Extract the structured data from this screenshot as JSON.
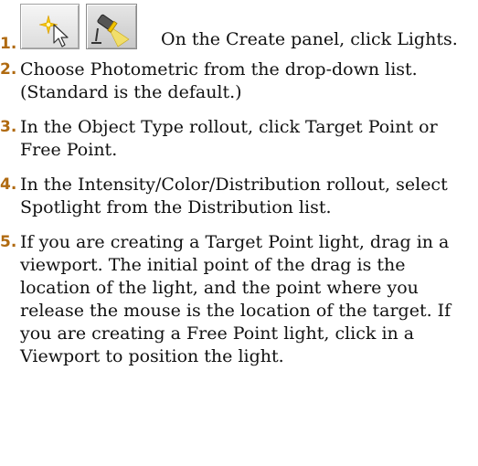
{
  "steps": [
    {
      "number": "1.",
      "text": "On the Create panel, click Lights."
    },
    {
      "number": "2.",
      "text": "Choose Photometric from the drop-down list. (Standard is the default.)"
    },
    {
      "number": "3.",
      "text": "In the Object Type rollout, click Target Point or Free Point."
    },
    {
      "number": "4.",
      "text": "In the Intensity/Color/Distribution rollout, select Spotlight from the Distribution list."
    },
    {
      "number": "5.",
      "text": "If you are creating a Target Point light, drag in a viewport. The initial point of the drag is the location of the light, and the point where you release the mouse is the location of the target. If you are creating a Free Point light, click in a Viewport to position the light."
    }
  ],
  "icons": {
    "create_tab": "create-panel-icon",
    "lights_button": "lights-icon"
  },
  "colors": {
    "step_number": "#b06a10",
    "text": "#111111"
  }
}
